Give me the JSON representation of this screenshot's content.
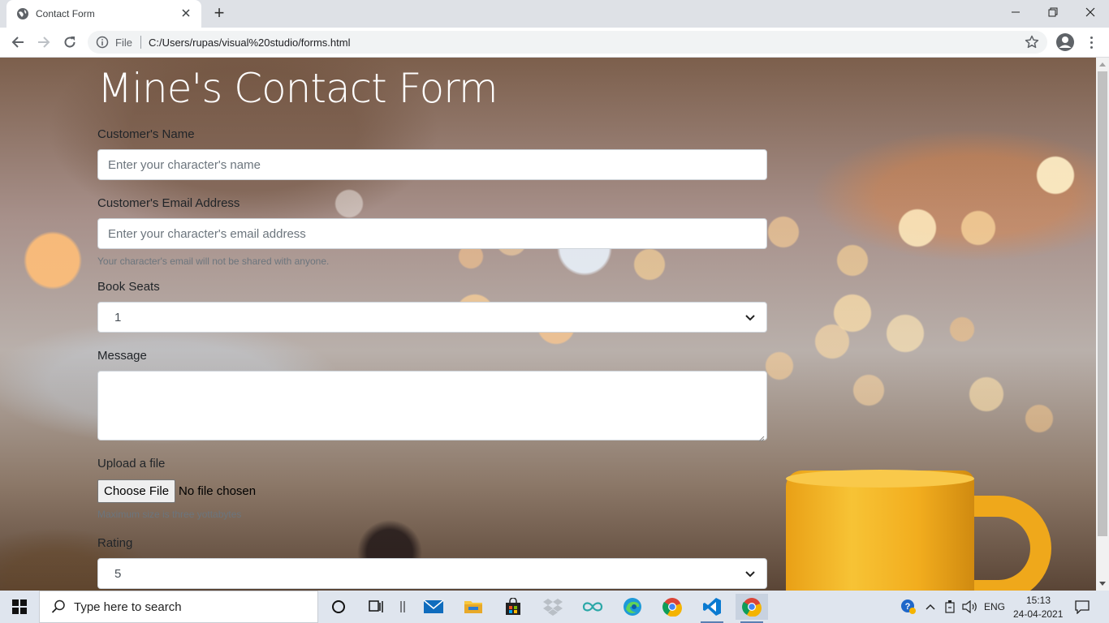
{
  "browser": {
    "tab_title": "Contact Form",
    "new_tab_label": "+",
    "address_scheme": "File",
    "address_url": "C:/Users/rupas/visual%20studio/forms.html"
  },
  "page": {
    "title": "Mine's Contact Form",
    "name_label": "Customer's Name",
    "name_placeholder": "Enter your character's name",
    "email_label": "Customer's Email Address",
    "email_placeholder": "Enter your character's email address",
    "email_hint": "Your character's email will not be shared with anyone.",
    "seats_label": "Book Seats",
    "seats_value": "1",
    "message_label": "Message",
    "upload_label": "Upload a file",
    "upload_button": "Choose File",
    "upload_status": "No file chosen",
    "upload_hint": "Maximum size is three yottabytes",
    "rating_label": "Rating",
    "rating_value": "5"
  },
  "taskbar": {
    "search_placeholder": "Type here to search",
    "language": "ENG",
    "time": "15:13",
    "date": "24-04-2021"
  },
  "colors": {
    "chrome_tabbar": "#dee1e6",
    "taskbar": "#dfe5ee",
    "vscode_blue": "#0a7ad1",
    "edge_teal": "#1e9ad8",
    "chrome_red": "#db4437",
    "chrome_yellow": "#f4b400",
    "chrome_green": "#0f9d58",
    "cup_yellow": "#f2ad1e"
  }
}
